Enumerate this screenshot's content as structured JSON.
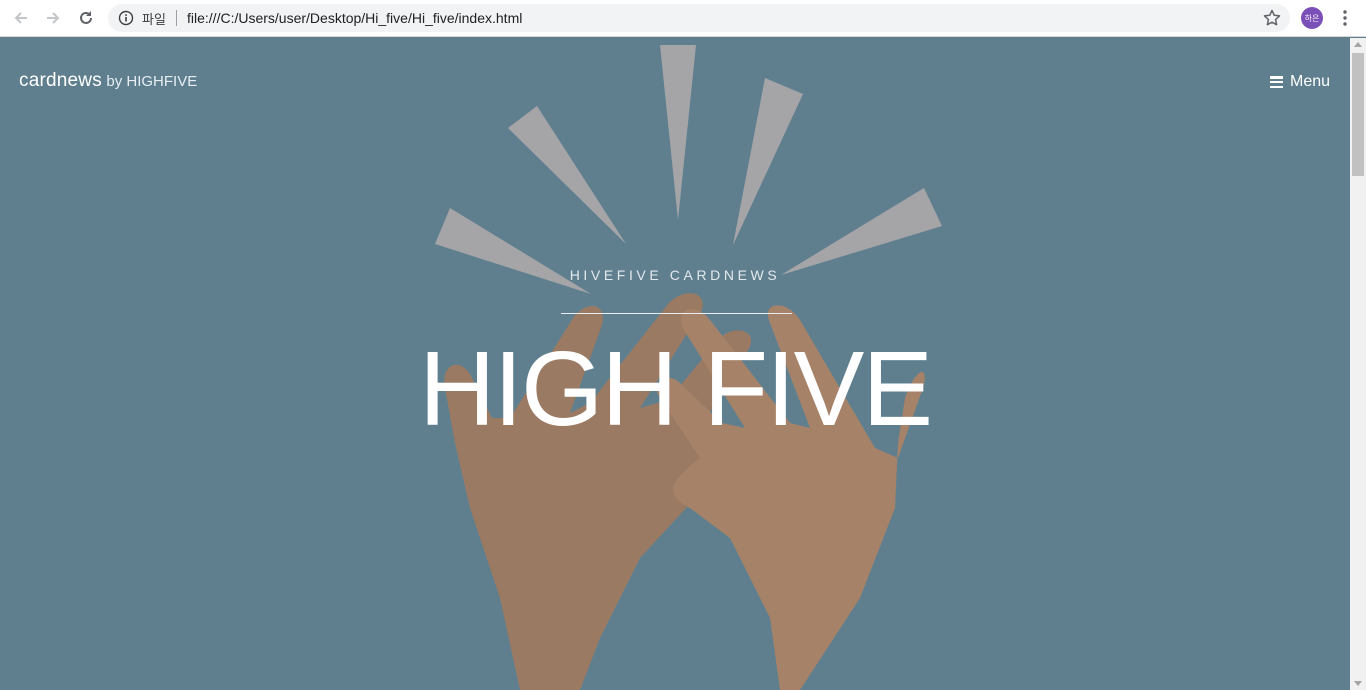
{
  "browser": {
    "scheme_label": "파일",
    "url": "file:///C:/Users/user/Desktop/Hi_five/Hi_five/index.html",
    "profile_initials": "하은",
    "icons": [
      "back-arrow-icon",
      "forward-arrow-icon",
      "reload-icon",
      "info-icon",
      "star-icon",
      "kebab-menu-icon"
    ]
  },
  "page": {
    "brand_main": "cardnews",
    "brand_sub": "by HIGHFIVE",
    "menu_label": "Menu",
    "kicker": "HIVEFIVE CARDNEWS",
    "headline": "HIGH FIVE",
    "colors": {
      "background": "#5f7f8f",
      "hand_left": "#9a7a62",
      "hand_right": "#a58268",
      "burst": "#a5a5a8",
      "text": "#ffffff"
    }
  }
}
